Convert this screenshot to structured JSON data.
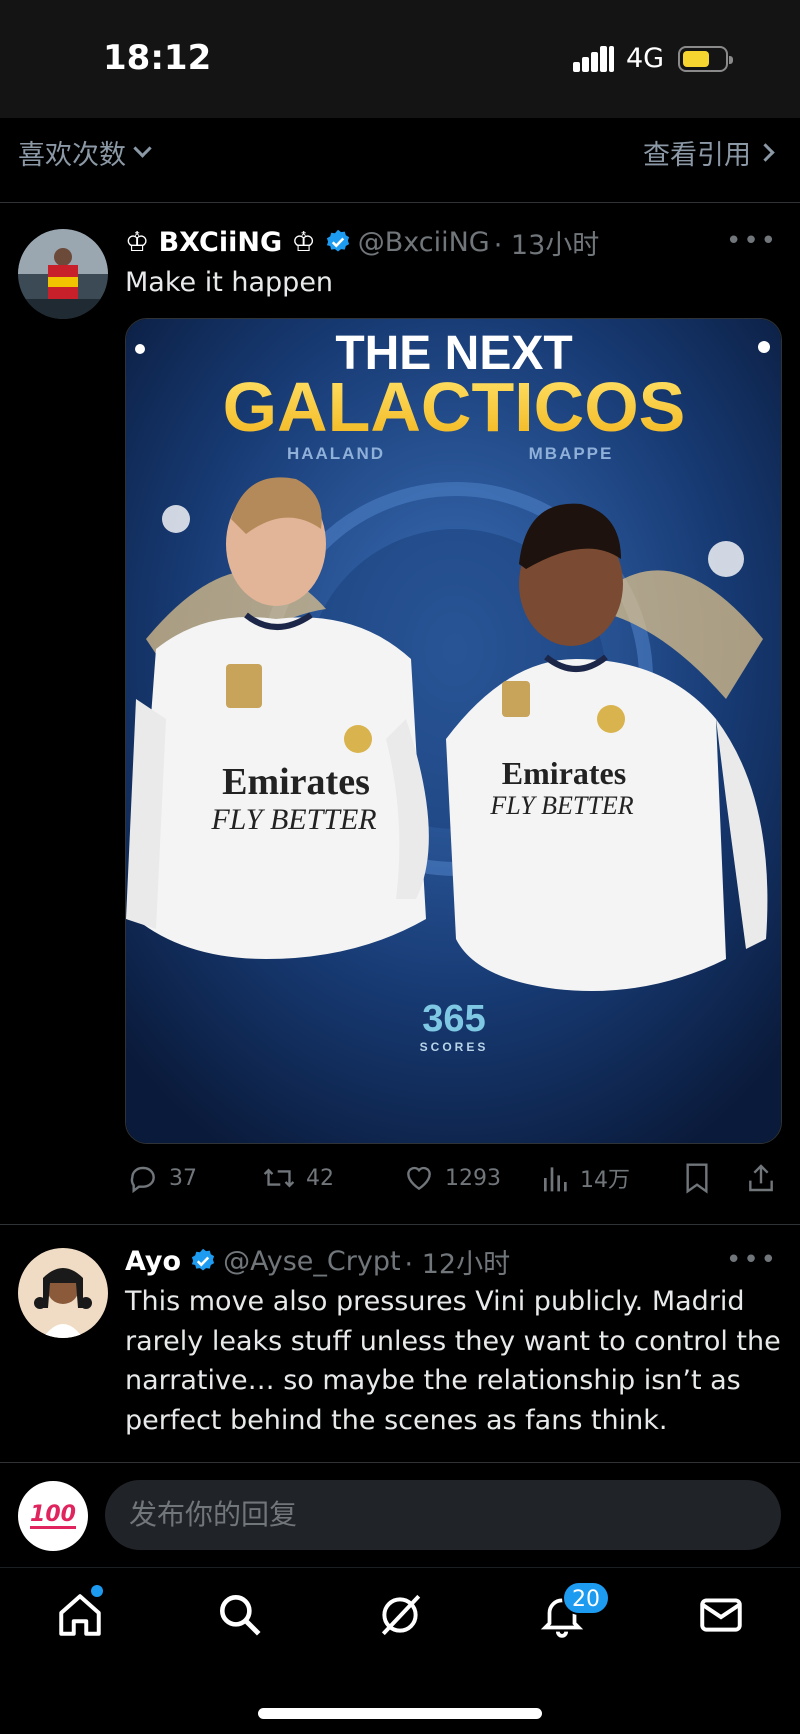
{
  "status_bar": {
    "time": "18:12",
    "network": "4G",
    "battery_color": "#f7d531"
  },
  "quote_bar": {
    "likes_label": "喜欢次数",
    "view_quotes_label": "查看引用"
  },
  "tweet_main": {
    "display_name": "♔ BXCiiNG ♔",
    "handle": "@BxciiNG",
    "time": "· 13小时",
    "text": "Make it happen",
    "media": {
      "headline_1": "THE NEXT",
      "headline_2": "GALACTICOS",
      "player_left": "HAALAND",
      "player_right": "MBAPPE",
      "sponsor_1": "Emirates",
      "sponsor_2": "FLY BETTER",
      "brand_top": "365",
      "brand_bottom": "SCORES"
    },
    "replies": "37",
    "retweets": "42",
    "likes": "1293",
    "views": "14万"
  },
  "tweet_reply": {
    "display_name": "Ayo",
    "handle": "@Ayse_Crypt",
    "time": "· 12小时",
    "text": "This move also pressures Vini publicly. Madrid rarely leaks stuff unless they want to control the narrative… so maybe the relationship isn’t as perfect behind the scenes as fans think."
  },
  "reply_composer": {
    "avatar_emoji": "100",
    "placeholder": "发布你的回复"
  },
  "tabbar": {
    "notifications_badge": "20"
  },
  "colors": {
    "accent": "#1d9bf0",
    "muted": "#71767b",
    "background": "#000000"
  }
}
